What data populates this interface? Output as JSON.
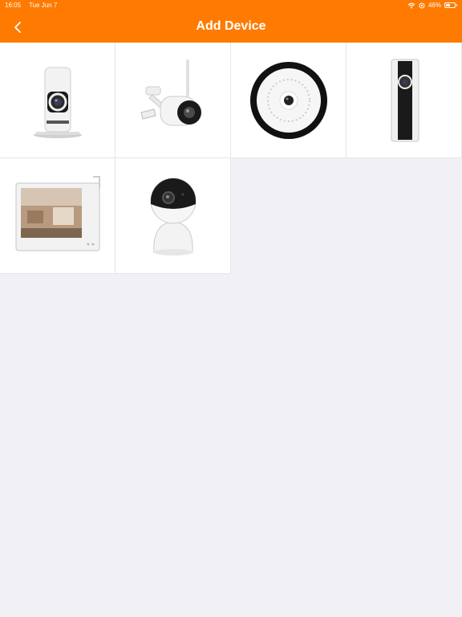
{
  "status_bar": {
    "time": "16:05",
    "date": "Tue Jun 7",
    "battery": "46%"
  },
  "header": {
    "title": "Add Device",
    "background": "#ff7a00"
  },
  "devices": [
    {
      "icon": "panoramic-wall-camera-icon"
    },
    {
      "icon": "outdoor-bullet-camera-icon"
    },
    {
      "icon": "fisheye-ceiling-camera-icon"
    },
    {
      "icon": "mini-door-camera-icon"
    },
    {
      "icon": "video-monitor-tablet-icon"
    },
    {
      "icon": "pan-tilt-dome-camera-icon"
    }
  ]
}
